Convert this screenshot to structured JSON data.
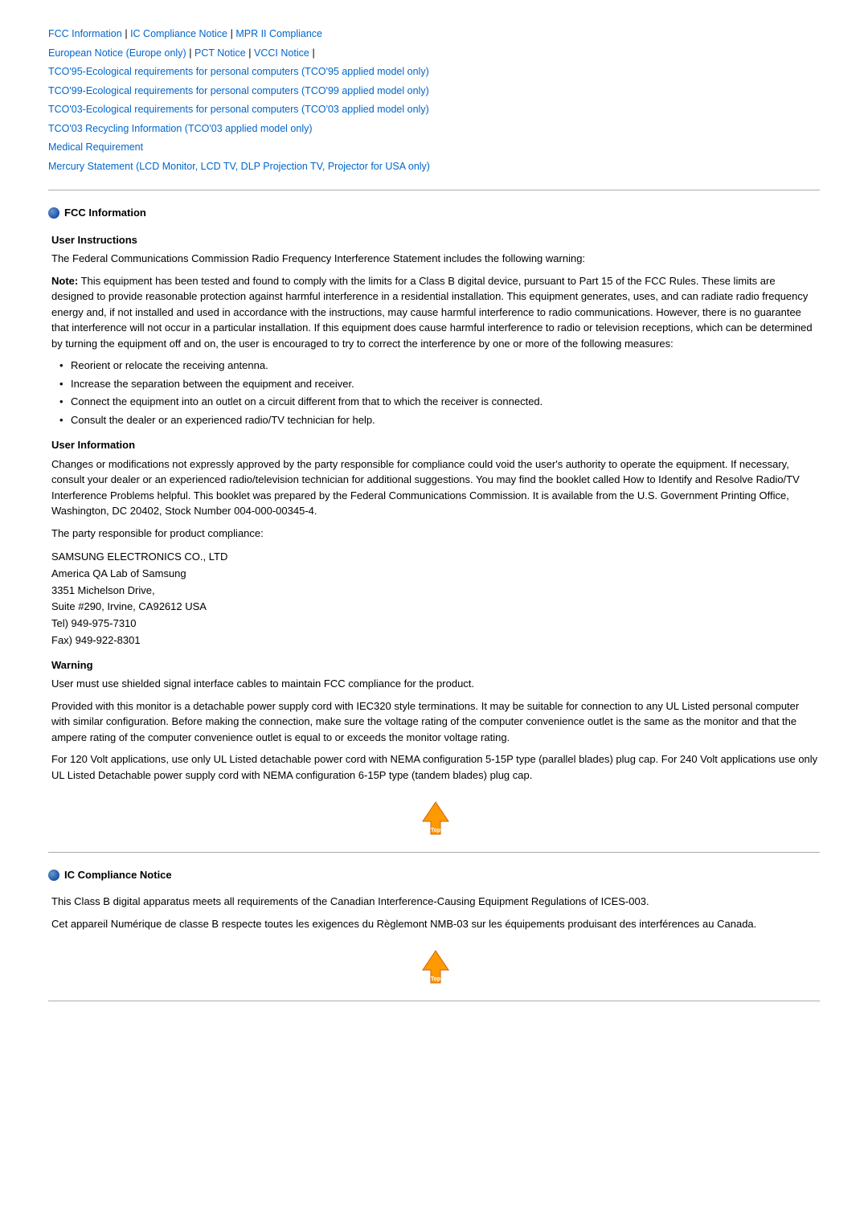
{
  "nav": {
    "links": [
      {
        "label": "FCC Information",
        "id": "fcc"
      },
      {
        "label": "IC Compliance Notice",
        "id": "ic"
      },
      {
        "label": "MPR II Compliance",
        "id": "mpr"
      },
      {
        "label": "European Notice (Europe only)",
        "id": "european"
      },
      {
        "label": "PCT Notice",
        "id": "pct"
      },
      {
        "label": "VCCI Notice",
        "id": "vcci"
      },
      {
        "label": "TCO'95-Ecological requirements for personal computers (TCO'95 applied model only)",
        "id": "tco95"
      },
      {
        "label": "TCO'99-Ecological requirements for personal computers (TCO'99 applied model only)",
        "id": "tco99"
      },
      {
        "label": "TCO'03-Ecological requirements for personal computers (TCO'03 applied model only)",
        "id": "tco03"
      },
      {
        "label": "TCO'03 Recycling Information (TCO'03 applied model only)",
        "id": "tco03r"
      },
      {
        "label": "Medical Requirement",
        "id": "medical"
      },
      {
        "label": "Mercury Statement (LCD Monitor, LCD TV, DLP Projection TV, Projector for USA only)",
        "id": "mercury"
      }
    ]
  },
  "fcc_section": {
    "title": "FCC Information",
    "user_instructions": {
      "subtitle": "User Instructions",
      "para1": "The Federal Communications Commission Radio Frequency Interference Statement includes the following warning:",
      "note_label": "Note:",
      "note_text": " This equipment has been tested and found to comply with the limits for a Class B digital device, pursuant to Part 15 of the FCC Rules. These limits are designed to provide reasonable protection against harmful interference in a residential installation. This equipment generates, uses, and can radiate radio frequency energy and, if not installed and used in accordance with the instructions, may cause harmful interference to radio communications. However, there is no guarantee that interference will not occur in a particular installation. If this equipment does cause harmful interference to radio or television receptions, which can be determined by turning the equipment off and on, the user is encouraged to try to correct the interference by one or more of the following measures:",
      "bullets": [
        "Reorient or relocate the receiving antenna.",
        "Increase the separation between the equipment and receiver.",
        "Connect the equipment into an outlet on a circuit different from that to which the receiver is connected.",
        "Consult the dealer or an experienced radio/TV technician for help."
      ]
    },
    "user_information": {
      "subtitle": "User Information",
      "para1": "Changes or modifications not expressly approved by the party responsible for compliance could void the user's authority to operate the equipment. If necessary, consult your dealer or an experienced radio/television technician for additional suggestions. You may find the booklet called How to Identify and Resolve Radio/TV Interference Problems helpful. This booklet was prepared by the Federal Communications Commission. It is available from the U.S. Government Printing Office, Washington, DC 20402, Stock Number 004-000-00345-4.",
      "para2": "The party responsible for product compliance:",
      "address": "SAMSUNG ELECTRONICS CO., LTD\nAmerica QA Lab of Samsung\n3351 Michelson Drive,\nSuite #290, Irvine, CA92612 USA\nTel) 949-975-7310\nFax) 949-922-8301"
    },
    "warning": {
      "title": "Warning",
      "para1": "User must use shielded signal interface cables to maintain FCC compliance for the product.",
      "para2": "Provided with this monitor is a detachable power supply cord with IEC320 style terminations. It may be suitable for connection to any UL Listed personal computer with similar configuration. Before making the connection, make sure the voltage rating of the computer convenience outlet is the same as the monitor and that the ampere rating of the computer convenience outlet is equal to or exceeds the monitor voltage rating.",
      "para3": "For 120 Volt applications, use only UL Listed detachable power cord with NEMA configuration 5-15P type (parallel blades) plug cap. For 240 Volt applications use only UL Listed Detachable power supply cord with NEMA configuration 6-15P type (tandem blades) plug cap."
    },
    "top_button_label": "Top"
  },
  "ic_section": {
    "title": "IC Compliance Notice",
    "para1": "This Class B digital apparatus meets all requirements of the Canadian Interference-Causing Equipment Regulations of ICES-003.",
    "para2": "Cet appareil Numérique de classe B respecte toutes les exigences du Règlemont NMB-03 sur les équipements produisant des interférences au Canada.",
    "top_button_label": "Top"
  }
}
